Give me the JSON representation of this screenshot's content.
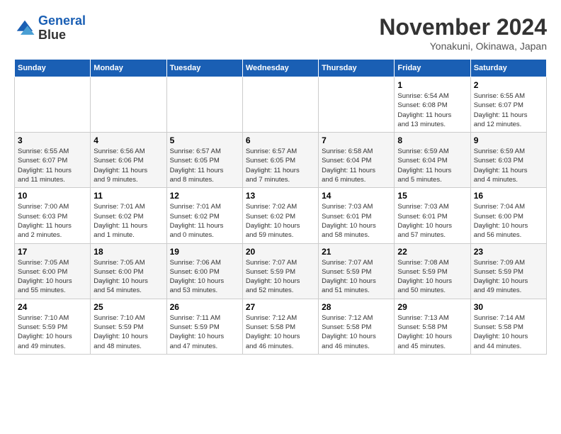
{
  "logo": {
    "line1": "General",
    "line2": "Blue"
  },
  "title": "November 2024",
  "location": "Yonakuni, Okinawa, Japan",
  "weekdays": [
    "Sunday",
    "Monday",
    "Tuesday",
    "Wednesday",
    "Thursday",
    "Friday",
    "Saturday"
  ],
  "weeks": [
    [
      {
        "day": "",
        "info": ""
      },
      {
        "day": "",
        "info": ""
      },
      {
        "day": "",
        "info": ""
      },
      {
        "day": "",
        "info": ""
      },
      {
        "day": "",
        "info": ""
      },
      {
        "day": "1",
        "info": "Sunrise: 6:54 AM\nSunset: 6:08 PM\nDaylight: 11 hours\nand 13 minutes."
      },
      {
        "day": "2",
        "info": "Sunrise: 6:55 AM\nSunset: 6:07 PM\nDaylight: 11 hours\nand 12 minutes."
      }
    ],
    [
      {
        "day": "3",
        "info": "Sunrise: 6:55 AM\nSunset: 6:07 PM\nDaylight: 11 hours\nand 11 minutes."
      },
      {
        "day": "4",
        "info": "Sunrise: 6:56 AM\nSunset: 6:06 PM\nDaylight: 11 hours\nand 9 minutes."
      },
      {
        "day": "5",
        "info": "Sunrise: 6:57 AM\nSunset: 6:05 PM\nDaylight: 11 hours\nand 8 minutes."
      },
      {
        "day": "6",
        "info": "Sunrise: 6:57 AM\nSunset: 6:05 PM\nDaylight: 11 hours\nand 7 minutes."
      },
      {
        "day": "7",
        "info": "Sunrise: 6:58 AM\nSunset: 6:04 PM\nDaylight: 11 hours\nand 6 minutes."
      },
      {
        "day": "8",
        "info": "Sunrise: 6:59 AM\nSunset: 6:04 PM\nDaylight: 11 hours\nand 5 minutes."
      },
      {
        "day": "9",
        "info": "Sunrise: 6:59 AM\nSunset: 6:03 PM\nDaylight: 11 hours\nand 4 minutes."
      }
    ],
    [
      {
        "day": "10",
        "info": "Sunrise: 7:00 AM\nSunset: 6:03 PM\nDaylight: 11 hours\nand 2 minutes."
      },
      {
        "day": "11",
        "info": "Sunrise: 7:01 AM\nSunset: 6:02 PM\nDaylight: 11 hours\nand 1 minute."
      },
      {
        "day": "12",
        "info": "Sunrise: 7:01 AM\nSunset: 6:02 PM\nDaylight: 11 hours\nand 0 minutes."
      },
      {
        "day": "13",
        "info": "Sunrise: 7:02 AM\nSunset: 6:02 PM\nDaylight: 10 hours\nand 59 minutes."
      },
      {
        "day": "14",
        "info": "Sunrise: 7:03 AM\nSunset: 6:01 PM\nDaylight: 10 hours\nand 58 minutes."
      },
      {
        "day": "15",
        "info": "Sunrise: 7:03 AM\nSunset: 6:01 PM\nDaylight: 10 hours\nand 57 minutes."
      },
      {
        "day": "16",
        "info": "Sunrise: 7:04 AM\nSunset: 6:00 PM\nDaylight: 10 hours\nand 56 minutes."
      }
    ],
    [
      {
        "day": "17",
        "info": "Sunrise: 7:05 AM\nSunset: 6:00 PM\nDaylight: 10 hours\nand 55 minutes."
      },
      {
        "day": "18",
        "info": "Sunrise: 7:05 AM\nSunset: 6:00 PM\nDaylight: 10 hours\nand 54 minutes."
      },
      {
        "day": "19",
        "info": "Sunrise: 7:06 AM\nSunset: 6:00 PM\nDaylight: 10 hours\nand 53 minutes."
      },
      {
        "day": "20",
        "info": "Sunrise: 7:07 AM\nSunset: 5:59 PM\nDaylight: 10 hours\nand 52 minutes."
      },
      {
        "day": "21",
        "info": "Sunrise: 7:07 AM\nSunset: 5:59 PM\nDaylight: 10 hours\nand 51 minutes."
      },
      {
        "day": "22",
        "info": "Sunrise: 7:08 AM\nSunset: 5:59 PM\nDaylight: 10 hours\nand 50 minutes."
      },
      {
        "day": "23",
        "info": "Sunrise: 7:09 AM\nSunset: 5:59 PM\nDaylight: 10 hours\nand 49 minutes."
      }
    ],
    [
      {
        "day": "24",
        "info": "Sunrise: 7:10 AM\nSunset: 5:59 PM\nDaylight: 10 hours\nand 49 minutes."
      },
      {
        "day": "25",
        "info": "Sunrise: 7:10 AM\nSunset: 5:59 PM\nDaylight: 10 hours\nand 48 minutes."
      },
      {
        "day": "26",
        "info": "Sunrise: 7:11 AM\nSunset: 5:59 PM\nDaylight: 10 hours\nand 47 minutes."
      },
      {
        "day": "27",
        "info": "Sunrise: 7:12 AM\nSunset: 5:58 PM\nDaylight: 10 hours\nand 46 minutes."
      },
      {
        "day": "28",
        "info": "Sunrise: 7:12 AM\nSunset: 5:58 PM\nDaylight: 10 hours\nand 46 minutes."
      },
      {
        "day": "29",
        "info": "Sunrise: 7:13 AM\nSunset: 5:58 PM\nDaylight: 10 hours\nand 45 minutes."
      },
      {
        "day": "30",
        "info": "Sunrise: 7:14 AM\nSunset: 5:58 PM\nDaylight: 10 hours\nand 44 minutes."
      }
    ]
  ]
}
